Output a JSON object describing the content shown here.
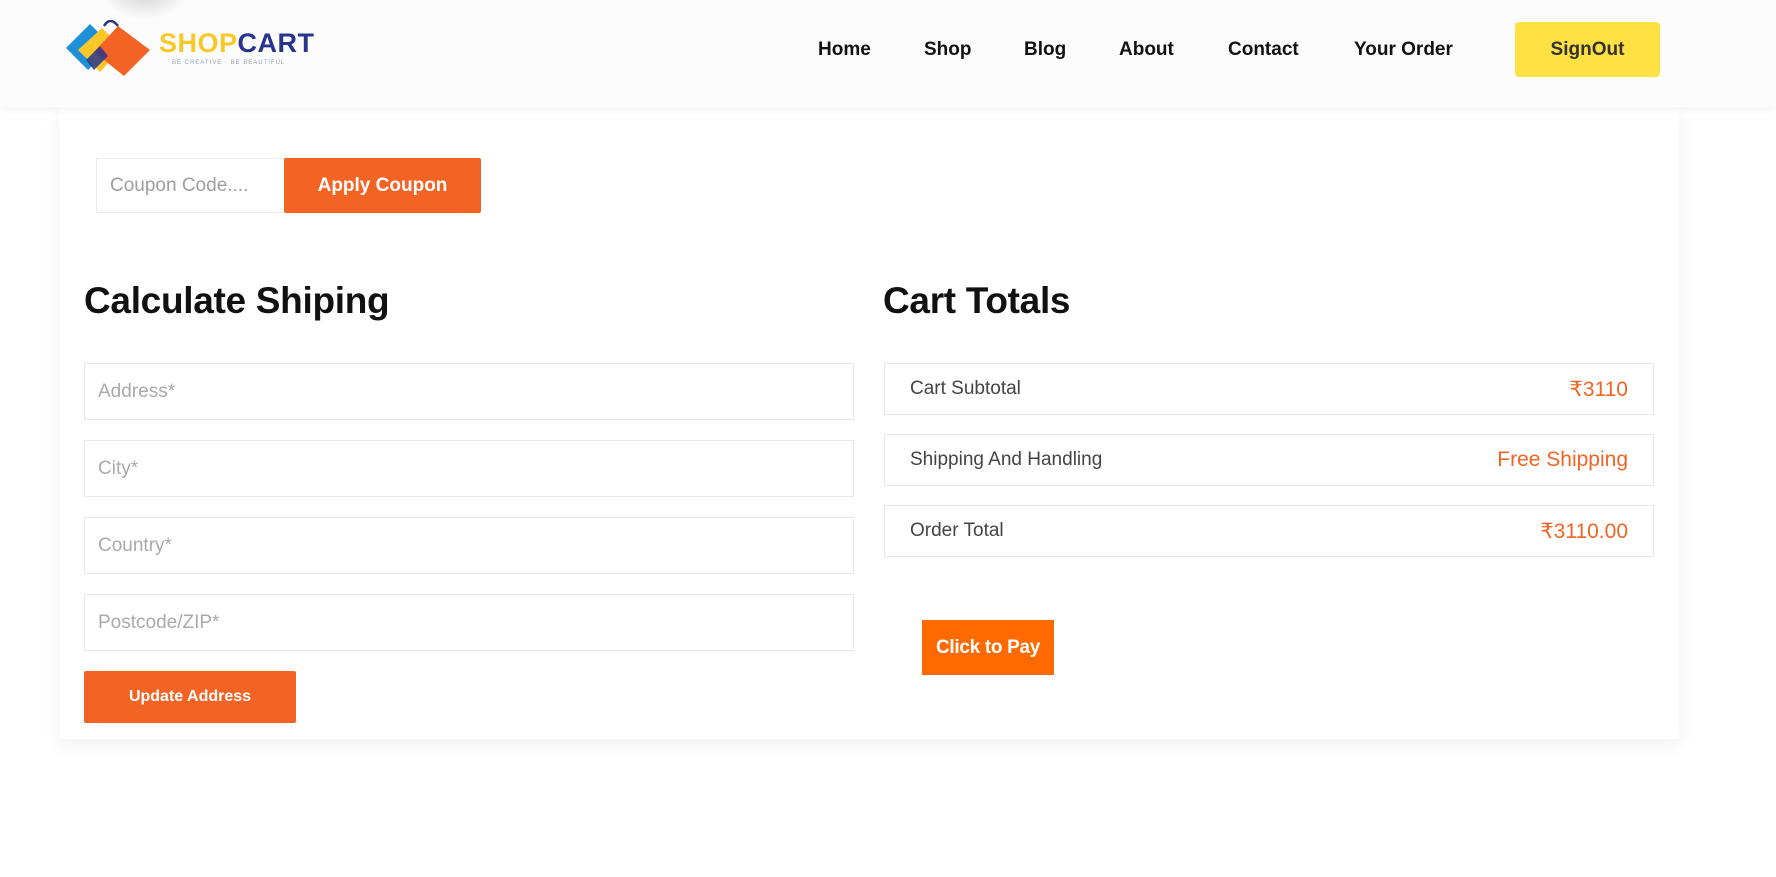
{
  "brand": {
    "name_part1": "SHOP",
    "name_part2": "CART",
    "tagline": "BE CREATIVE · BE BEAUTIFUL",
    "colors": {
      "shop": "#f9c828",
      "cart": "#28358c"
    }
  },
  "nav": {
    "items": [
      {
        "label": "Home"
      },
      {
        "label": "Shop"
      },
      {
        "label": "Blog"
      },
      {
        "label": "About"
      },
      {
        "label": "Contact"
      },
      {
        "label": "Your Order"
      }
    ],
    "signout_label": "SignOut"
  },
  "coupon": {
    "placeholder": "Coupon Code....",
    "apply_label": "Apply Coupon"
  },
  "shipping": {
    "title": "Calculate Shiping",
    "fields": [
      {
        "placeholder": "Address*"
      },
      {
        "placeholder": "City*"
      },
      {
        "placeholder": "Country*"
      },
      {
        "placeholder": "Postcode/ZIP*"
      }
    ],
    "update_label": "Update Address"
  },
  "totals": {
    "title": "Cart Totals",
    "rows": [
      {
        "label": "Cart Subtotal",
        "value": "₹3110"
      },
      {
        "label": "Shipping And Handling",
        "value": "Free Shipping"
      },
      {
        "label": "Order Total",
        "value": "₹3110.00"
      }
    ],
    "pay_label": "Click to Pay"
  },
  "colors": {
    "accent": "#f36424",
    "pay": "#ff6a00",
    "signout": "#ffe144"
  }
}
